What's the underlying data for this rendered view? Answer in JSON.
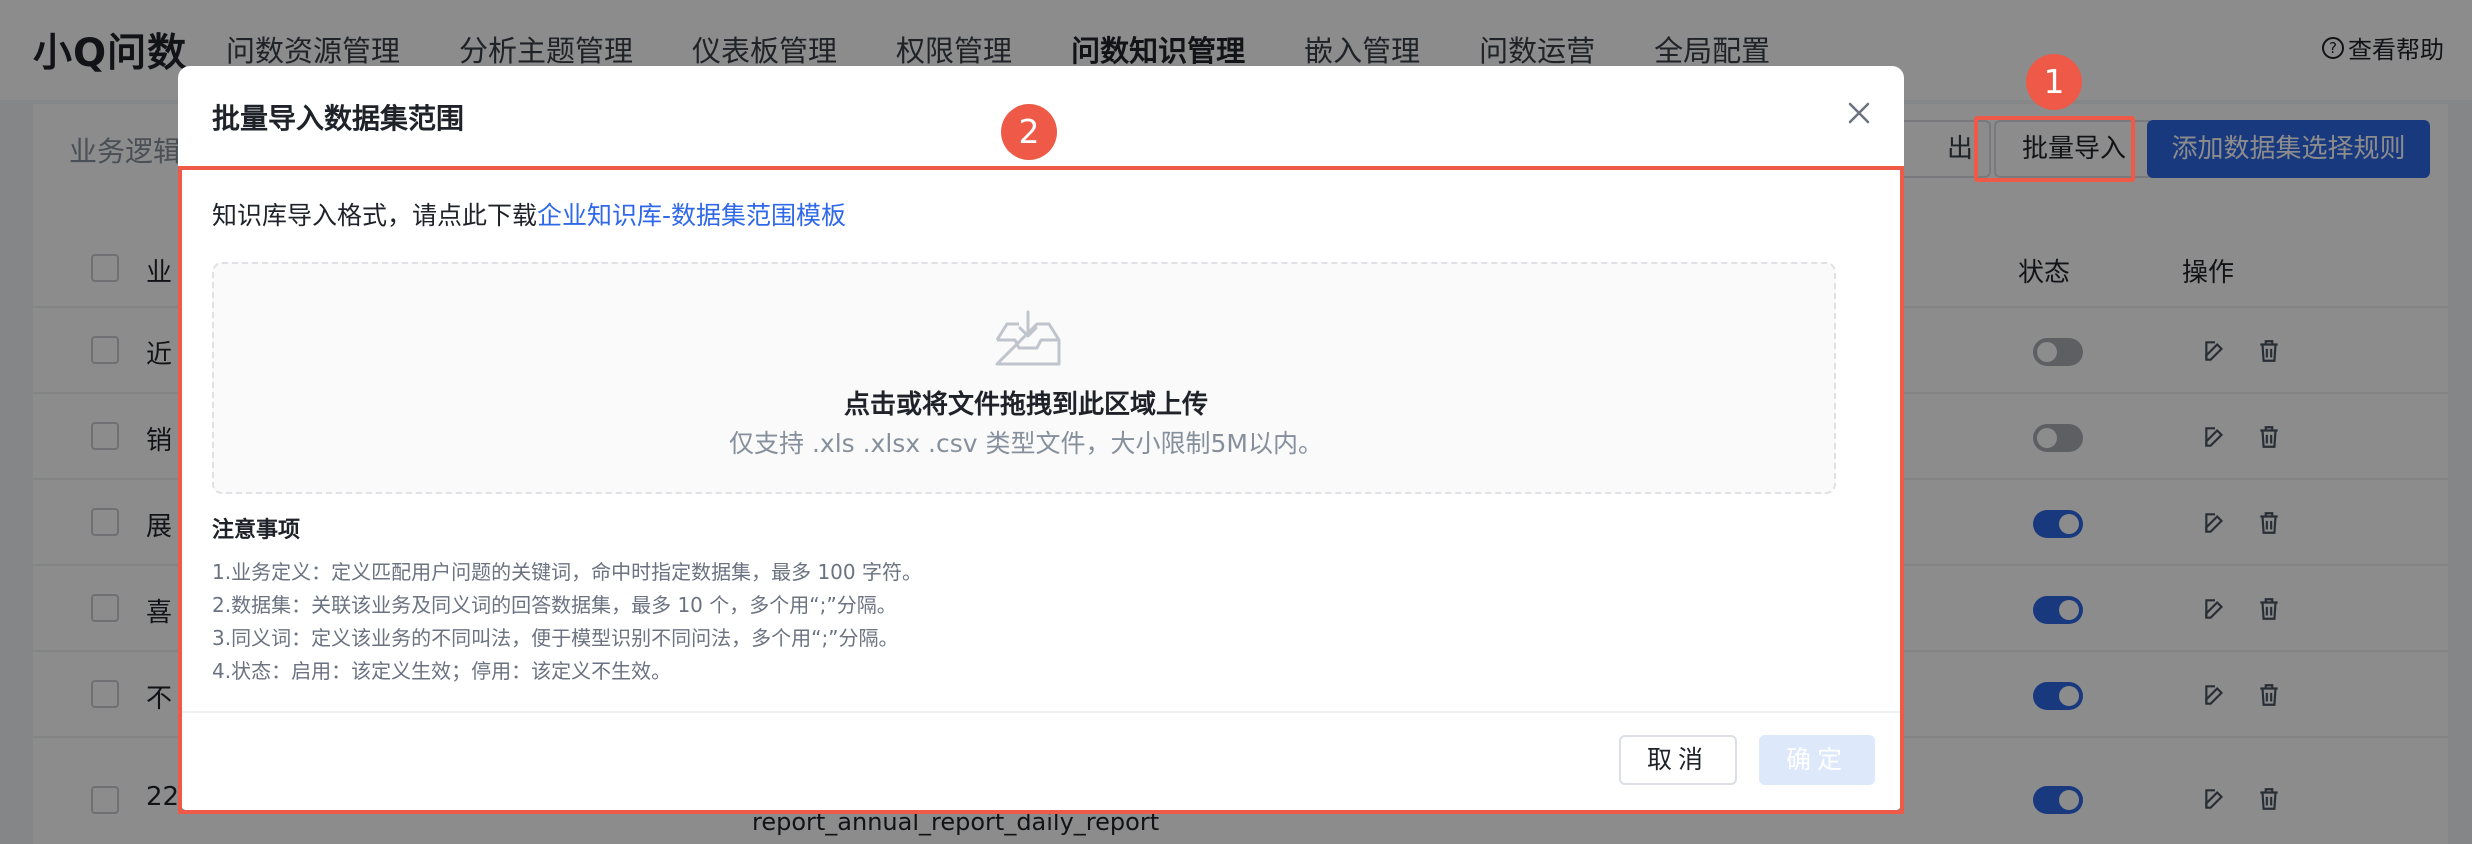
{
  "app": {
    "brand": "小Q问数"
  },
  "nav": {
    "items": [
      {
        "label": "问数资源管理"
      },
      {
        "label": "分析主题管理"
      },
      {
        "label": "仪表板管理"
      },
      {
        "label": "权限管理"
      },
      {
        "label": "问数知识管理"
      },
      {
        "label": "嵌入管理"
      },
      {
        "label": "问数运营"
      },
      {
        "label": "全局配置"
      }
    ],
    "active_index": 4,
    "help_label": "查看帮助"
  },
  "toolbar": {
    "filter_label": "业务逻辑",
    "export_label": "出",
    "batch_import_label": "批量导入",
    "add_rule_label": "添加数据集选择规则"
  },
  "table": {
    "headers": {
      "first": "业",
      "status": "状态",
      "ops": "操作"
    },
    "rows": [
      {
        "first": "近",
        "status": "off"
      },
      {
        "first": "销",
        "status": "off"
      },
      {
        "first": "展",
        "status": "on"
      },
      {
        "first": "喜",
        "status": "on"
      },
      {
        "first": "不",
        "status": "on"
      },
      {
        "first": "22",
        "status": "on",
        "sub": "report_annual_report_daily_report"
      }
    ]
  },
  "modal": {
    "title": "批量导入数据集范围",
    "template_prefix": "知识库导入格式，请点此下载",
    "template_link": "企业知识库-数据集范围模板",
    "upload_main": "点击或将文件拖拽到此区域上传",
    "upload_sub": "仅支持 .xls .xlsx .csv 类型文件，大小限制5M以内。",
    "notice_title": "注意事项",
    "notices": [
      "1.业务定义：定义匹配用户问题的关键词，命中时指定数据集，最多 100 字符。",
      "2.数据集：关联该业务及同义词的回答数据集，最多 10 个，多个用“;”分隔。",
      "3.同义词：定义该业务的不同叫法，便于模型识别不同问法，多个用“;”分隔。",
      "4.状态：启用：该定义生效；停用：该定义不生效。"
    ],
    "cancel_label": "取消",
    "confirm_label": "确定"
  },
  "annotations": {
    "badge_1": "1",
    "badge_2": "2"
  },
  "colors": {
    "primary": "#2f68e8",
    "annotation": "#ee5a47",
    "toggle_off": "#a9adb3"
  }
}
